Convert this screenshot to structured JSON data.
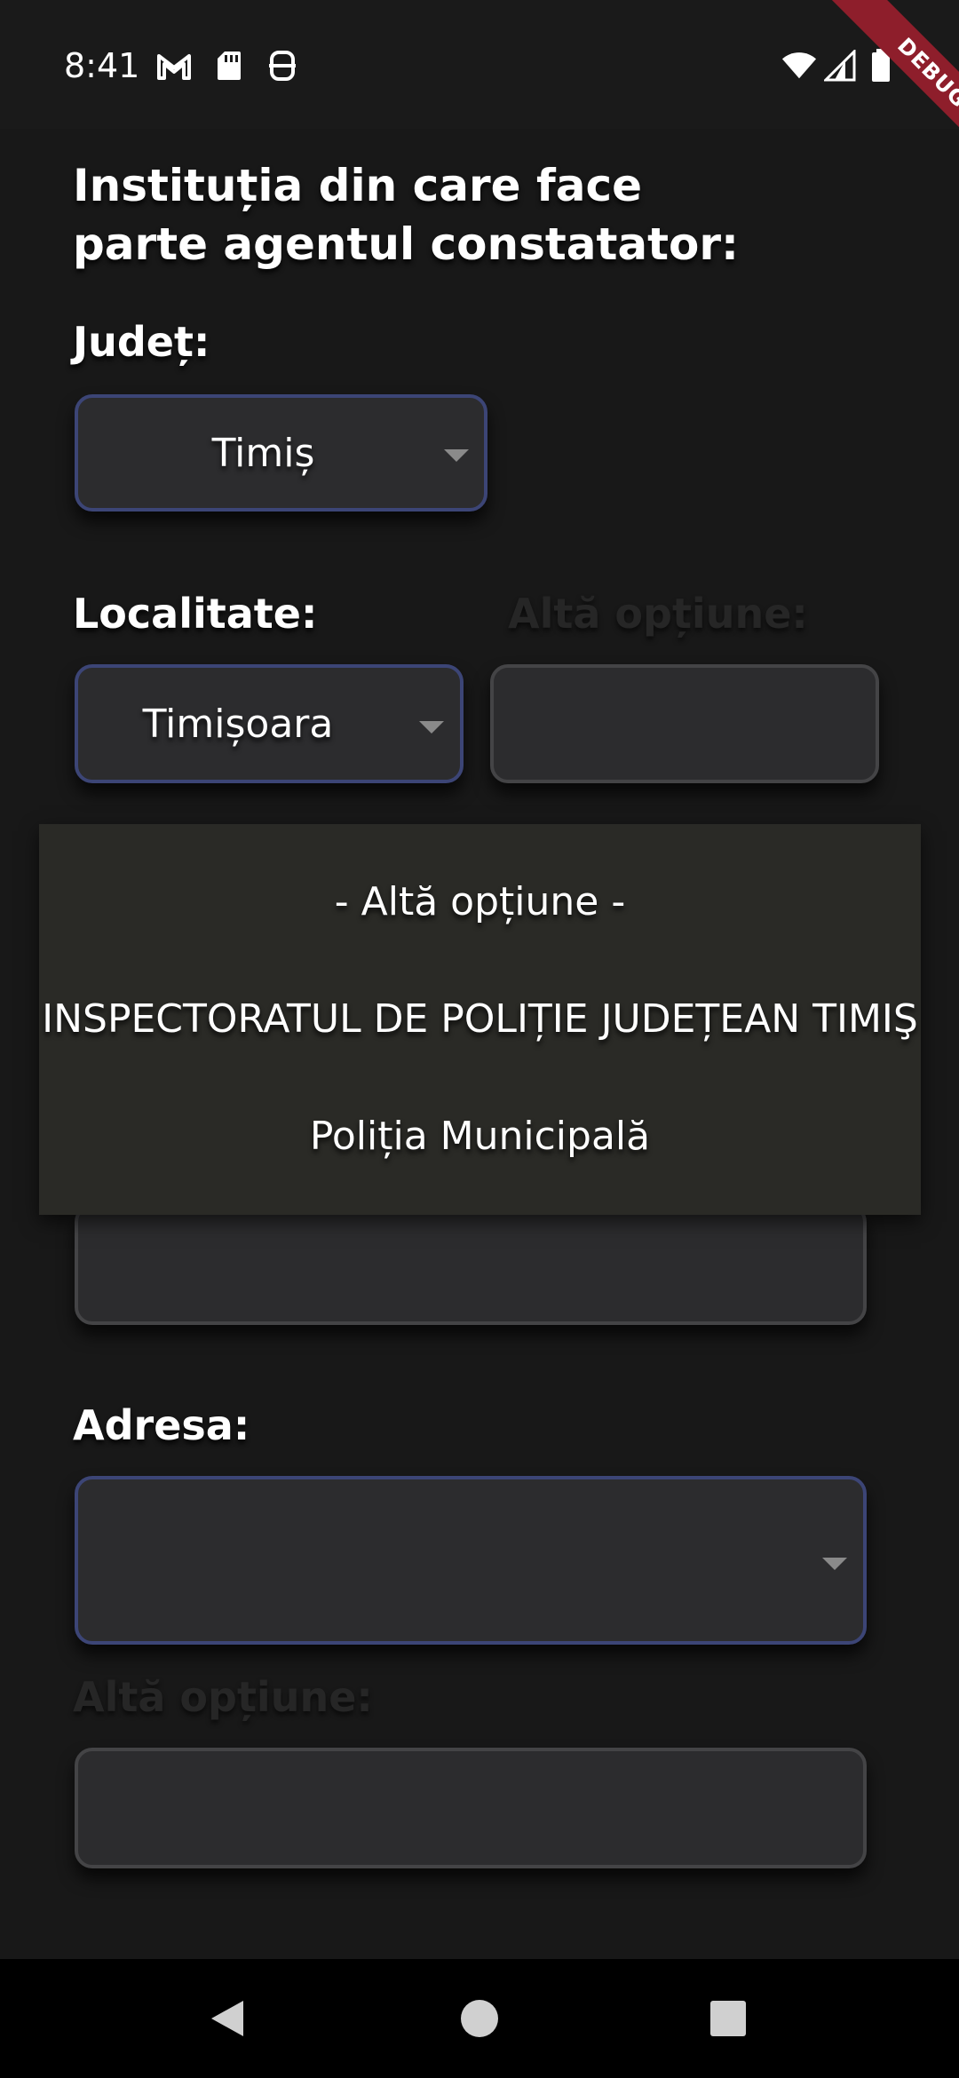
{
  "status_bar": {
    "time": "8:41",
    "icons": [
      "gmail-icon",
      "sd-card-icon",
      "assistant-icon",
      "wifi-icon",
      "signal-icon",
      "battery-icon"
    ]
  },
  "debug_banner": "DEBUG",
  "heading": "Instituția din care face parte agentul constatator:",
  "judet": {
    "label": "Județ:",
    "value": "Timiș"
  },
  "localitate": {
    "label": "Localitate:",
    "value": "Timișoara"
  },
  "alta_optiune_label": "Altă opțiune:",
  "menu": {
    "items": [
      "- Altă opțiune -",
      "INSPECTORATUL DE POLIȚIE JUDEȚEAN TIMIŞ",
      "Poliția Municipală"
    ]
  },
  "adresa": {
    "label": "Adresa:",
    "value": ""
  },
  "adresa_alta_optiune_label": "Altă opțiune:",
  "colors": {
    "background": "#181818",
    "field": "#2c2c2e",
    "dropdown_border": "#3c4576",
    "menu_background": "#2a2a26",
    "debug_banner": "#8e1e2b"
  }
}
